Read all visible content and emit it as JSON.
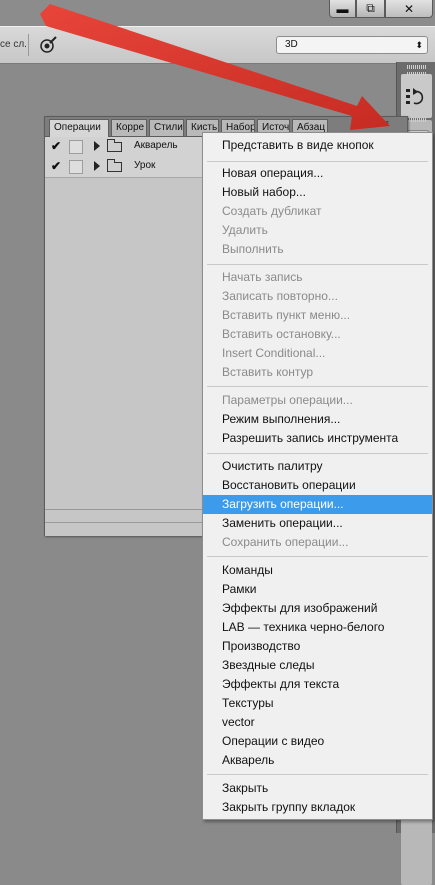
{
  "window": {
    "minimize_glyph": "▬",
    "restore_glyph": "⧉",
    "close_glyph": "✕"
  },
  "options_bar": {
    "partial_label": "се сл.",
    "mode_select": "3D",
    "tool_icon": "pressure-brush-icon"
  },
  "dock": {
    "history_icon": "history-icon"
  },
  "panel": {
    "tabs": [
      "Операции",
      "Корре",
      "Стили",
      "Кисть",
      "Набор",
      "Источ",
      "Абзац"
    ],
    "menu_button_glyph": "▾≡",
    "actions": [
      {
        "name": "Акварель",
        "checked": true
      },
      {
        "name": "Урок",
        "checked": true
      }
    ]
  },
  "menu": {
    "items": [
      {
        "label": "Представить в виде кнопок",
        "disabled": false
      },
      {
        "label": "Новая операция...",
        "disabled": false
      },
      {
        "label": "Новый набор...",
        "disabled": false
      },
      {
        "label": "Создать дубликат",
        "disabled": true
      },
      {
        "label": "Удалить",
        "disabled": true
      },
      {
        "label": "Выполнить",
        "disabled": true
      },
      {
        "label": "Начать запись",
        "disabled": true
      },
      {
        "label": "Записать повторно...",
        "disabled": true
      },
      {
        "label": "Вставить пункт меню...",
        "disabled": true
      },
      {
        "label": "Вставить остановку...",
        "disabled": true
      },
      {
        "label": "Insert Conditional...",
        "disabled": true
      },
      {
        "label": "Вставить контур",
        "disabled": true
      },
      {
        "label": "Параметры операции...",
        "disabled": true
      },
      {
        "label": "Режим выполнения...",
        "disabled": false
      },
      {
        "label": "Разрешить запись инструмента",
        "disabled": false
      },
      {
        "label": "Очистить палитру",
        "disabled": false
      },
      {
        "label": "Восстановить операции",
        "disabled": false
      },
      {
        "label": "Загрузить операции...",
        "disabled": false,
        "highlighted": true
      },
      {
        "label": "Заменить операции...",
        "disabled": false
      },
      {
        "label": "Сохранить операции...",
        "disabled": true
      },
      {
        "label": "Команды",
        "disabled": false
      },
      {
        "label": "Рамки",
        "disabled": false
      },
      {
        "label": "Эффекты для изображений",
        "disabled": false
      },
      {
        "label": "LAB — техника черно-белого",
        "disabled": false
      },
      {
        "label": "Производство",
        "disabled": false
      },
      {
        "label": "Звездные следы",
        "disabled": false
      },
      {
        "label": "Эффекты для текста",
        "disabled": false
      },
      {
        "label": "Текстуры",
        "disabled": false
      },
      {
        "label": "vector",
        "disabled": false
      },
      {
        "label": "Операции с видео",
        "disabled": false
      },
      {
        "label": "Акварель",
        "disabled": false
      },
      {
        "label": "Закрыть",
        "disabled": false
      },
      {
        "label": "Закрыть группу вкладок",
        "disabled": false
      }
    ]
  },
  "colors": {
    "highlight": "#3c9bea",
    "arrow": "#e0392b",
    "disabled_text": "#8a8a8a"
  }
}
